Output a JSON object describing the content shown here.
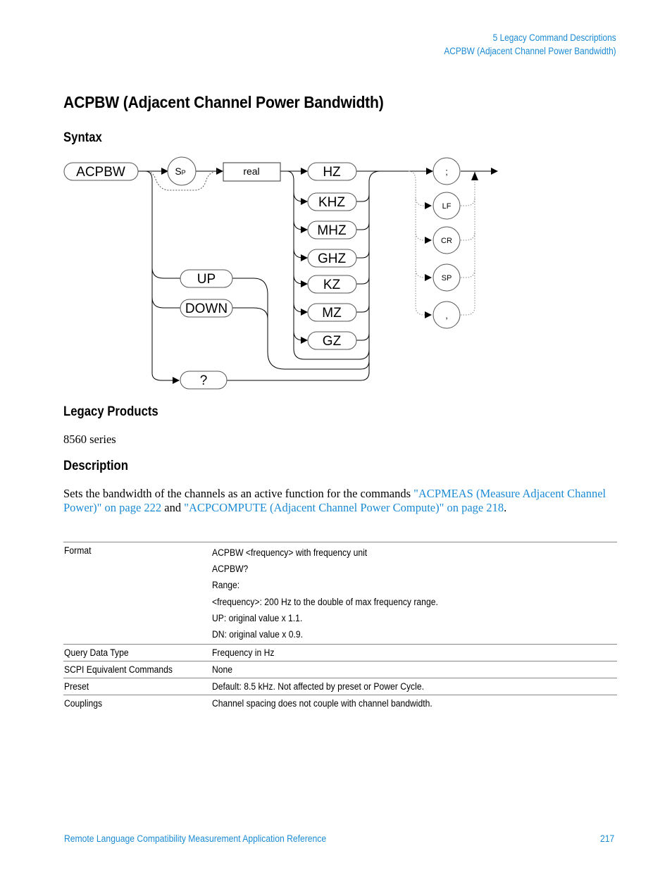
{
  "header": {
    "chapter": "5  Legacy Command Descriptions",
    "section": "ACPBW (Adjacent Channel Power Bandwidth)"
  },
  "title": "ACPBW (Adjacent Channel Power Bandwidth)",
  "syntax": {
    "heading": "Syntax",
    "diagram": {
      "command": "ACPBW",
      "space": "S",
      "space_sub": "P",
      "param": "real",
      "units": [
        "HZ",
        "KHZ",
        "MHZ",
        "GHZ",
        "KZ",
        "MZ",
        "GZ"
      ],
      "step_options": [
        "UP",
        "DOWN"
      ],
      "query": "?",
      "terminators": [
        ";",
        "LF",
        "CR",
        "SP",
        ","
      ]
    }
  },
  "legacy_products": {
    "heading": "Legacy Products",
    "text": "8560 series"
  },
  "description": {
    "heading": "Description",
    "text_before": "Sets the bandwidth of the channels as an active function for the commands ",
    "link1": "\"ACPMEAS (Measure Adjacent Channel Power)\" on page 222",
    "text_mid": " and ",
    "link2": "\"ACPCOMPUTE (Adjacent Channel Power Compute)\" on page 218",
    "text_after": "."
  },
  "table": {
    "rows": [
      {
        "key": "Format",
        "values": [
          "ACPBW <frequency> with frequency unit",
          "ACPBW?",
          "Range:",
          "<frequency>: 200 Hz to the double of max frequency range.",
          "UP: original value x 1.1.",
          "DN: original value x 0.9."
        ]
      },
      {
        "key": "Query Data Type",
        "values": [
          "Frequency in Hz"
        ]
      },
      {
        "key": "SCPI Equivalent Commands",
        "values": [
          "None"
        ]
      },
      {
        "key": "Preset",
        "values": [
          "Default: 8.5 kHz. Not affected by preset or Power Cycle."
        ]
      },
      {
        "key": "Couplings",
        "values": [
          "Channel spacing does not couple with channel bandwidth."
        ]
      }
    ]
  },
  "footer": {
    "title": "Remote Language Compatibility Measurement Application Reference",
    "page": "217"
  }
}
